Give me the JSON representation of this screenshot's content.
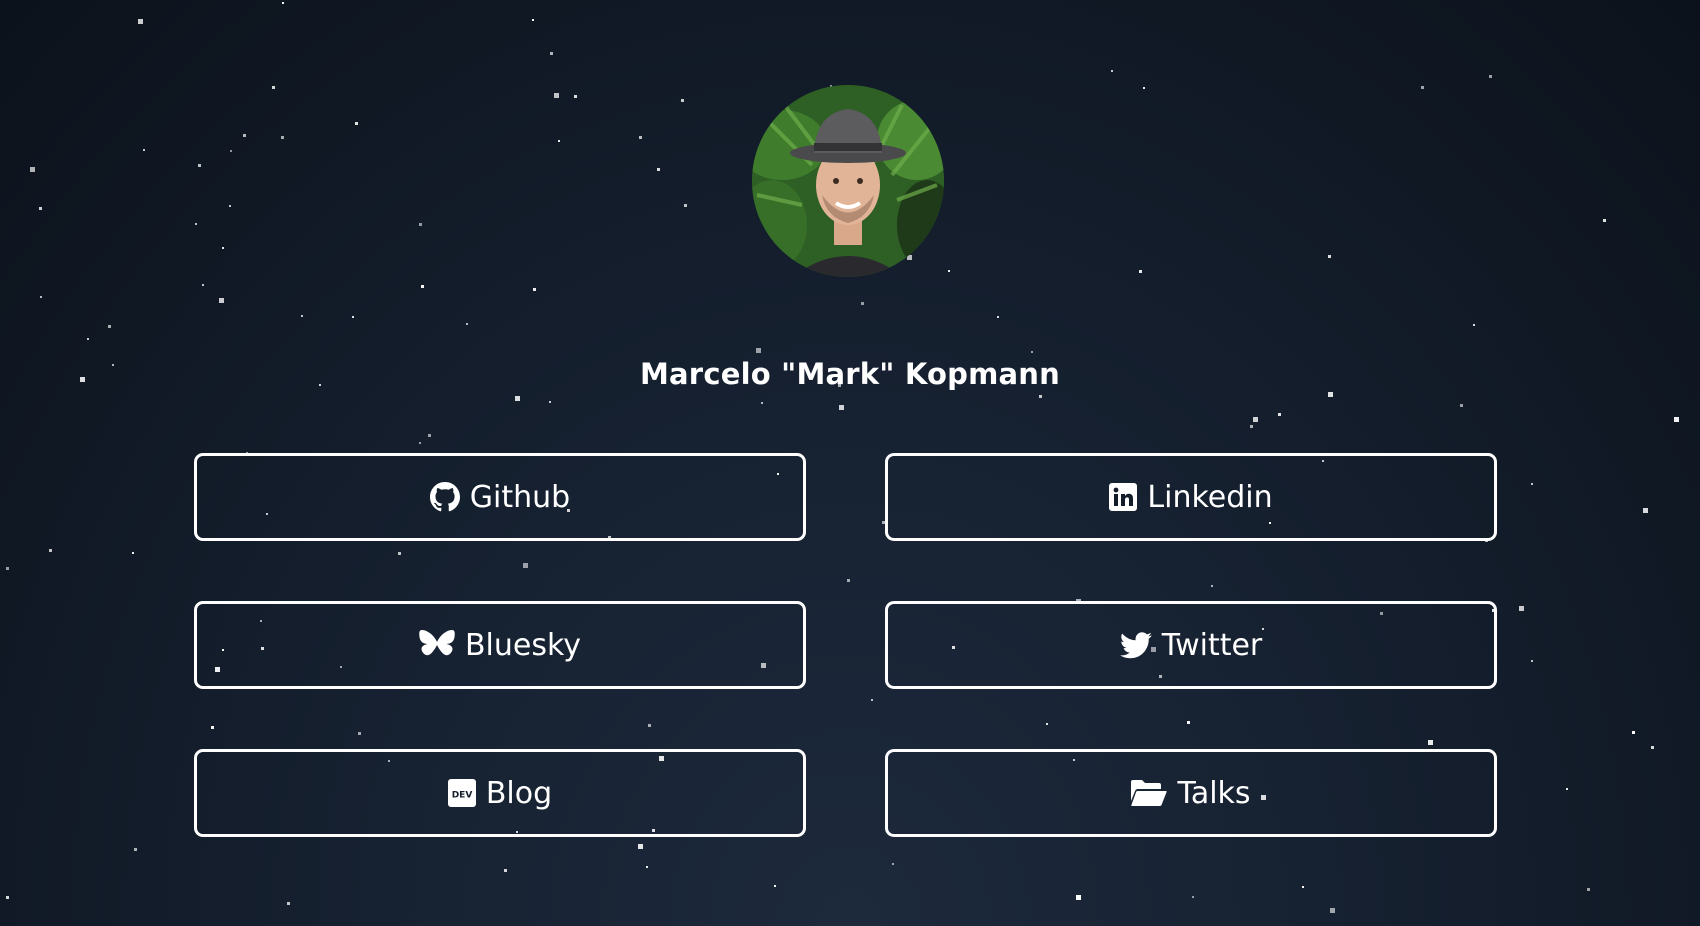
{
  "profile": {
    "name": "Marcelo \"Mark\" Kopmann",
    "avatar_icon": "profile-photo"
  },
  "links": [
    {
      "label": "Github",
      "icon": "github-icon"
    },
    {
      "label": "Linkedin",
      "icon": "linkedin-icon"
    },
    {
      "label": "Bluesky",
      "icon": "bluesky-icon"
    },
    {
      "label": "Twitter",
      "icon": "twitter-icon"
    },
    {
      "label": "Blog",
      "icon": "dev-icon"
    },
    {
      "label": "Talks",
      "icon": "folder-open-icon"
    }
  ],
  "colors": {
    "background": "#131c29",
    "foreground": "#ffffff"
  }
}
